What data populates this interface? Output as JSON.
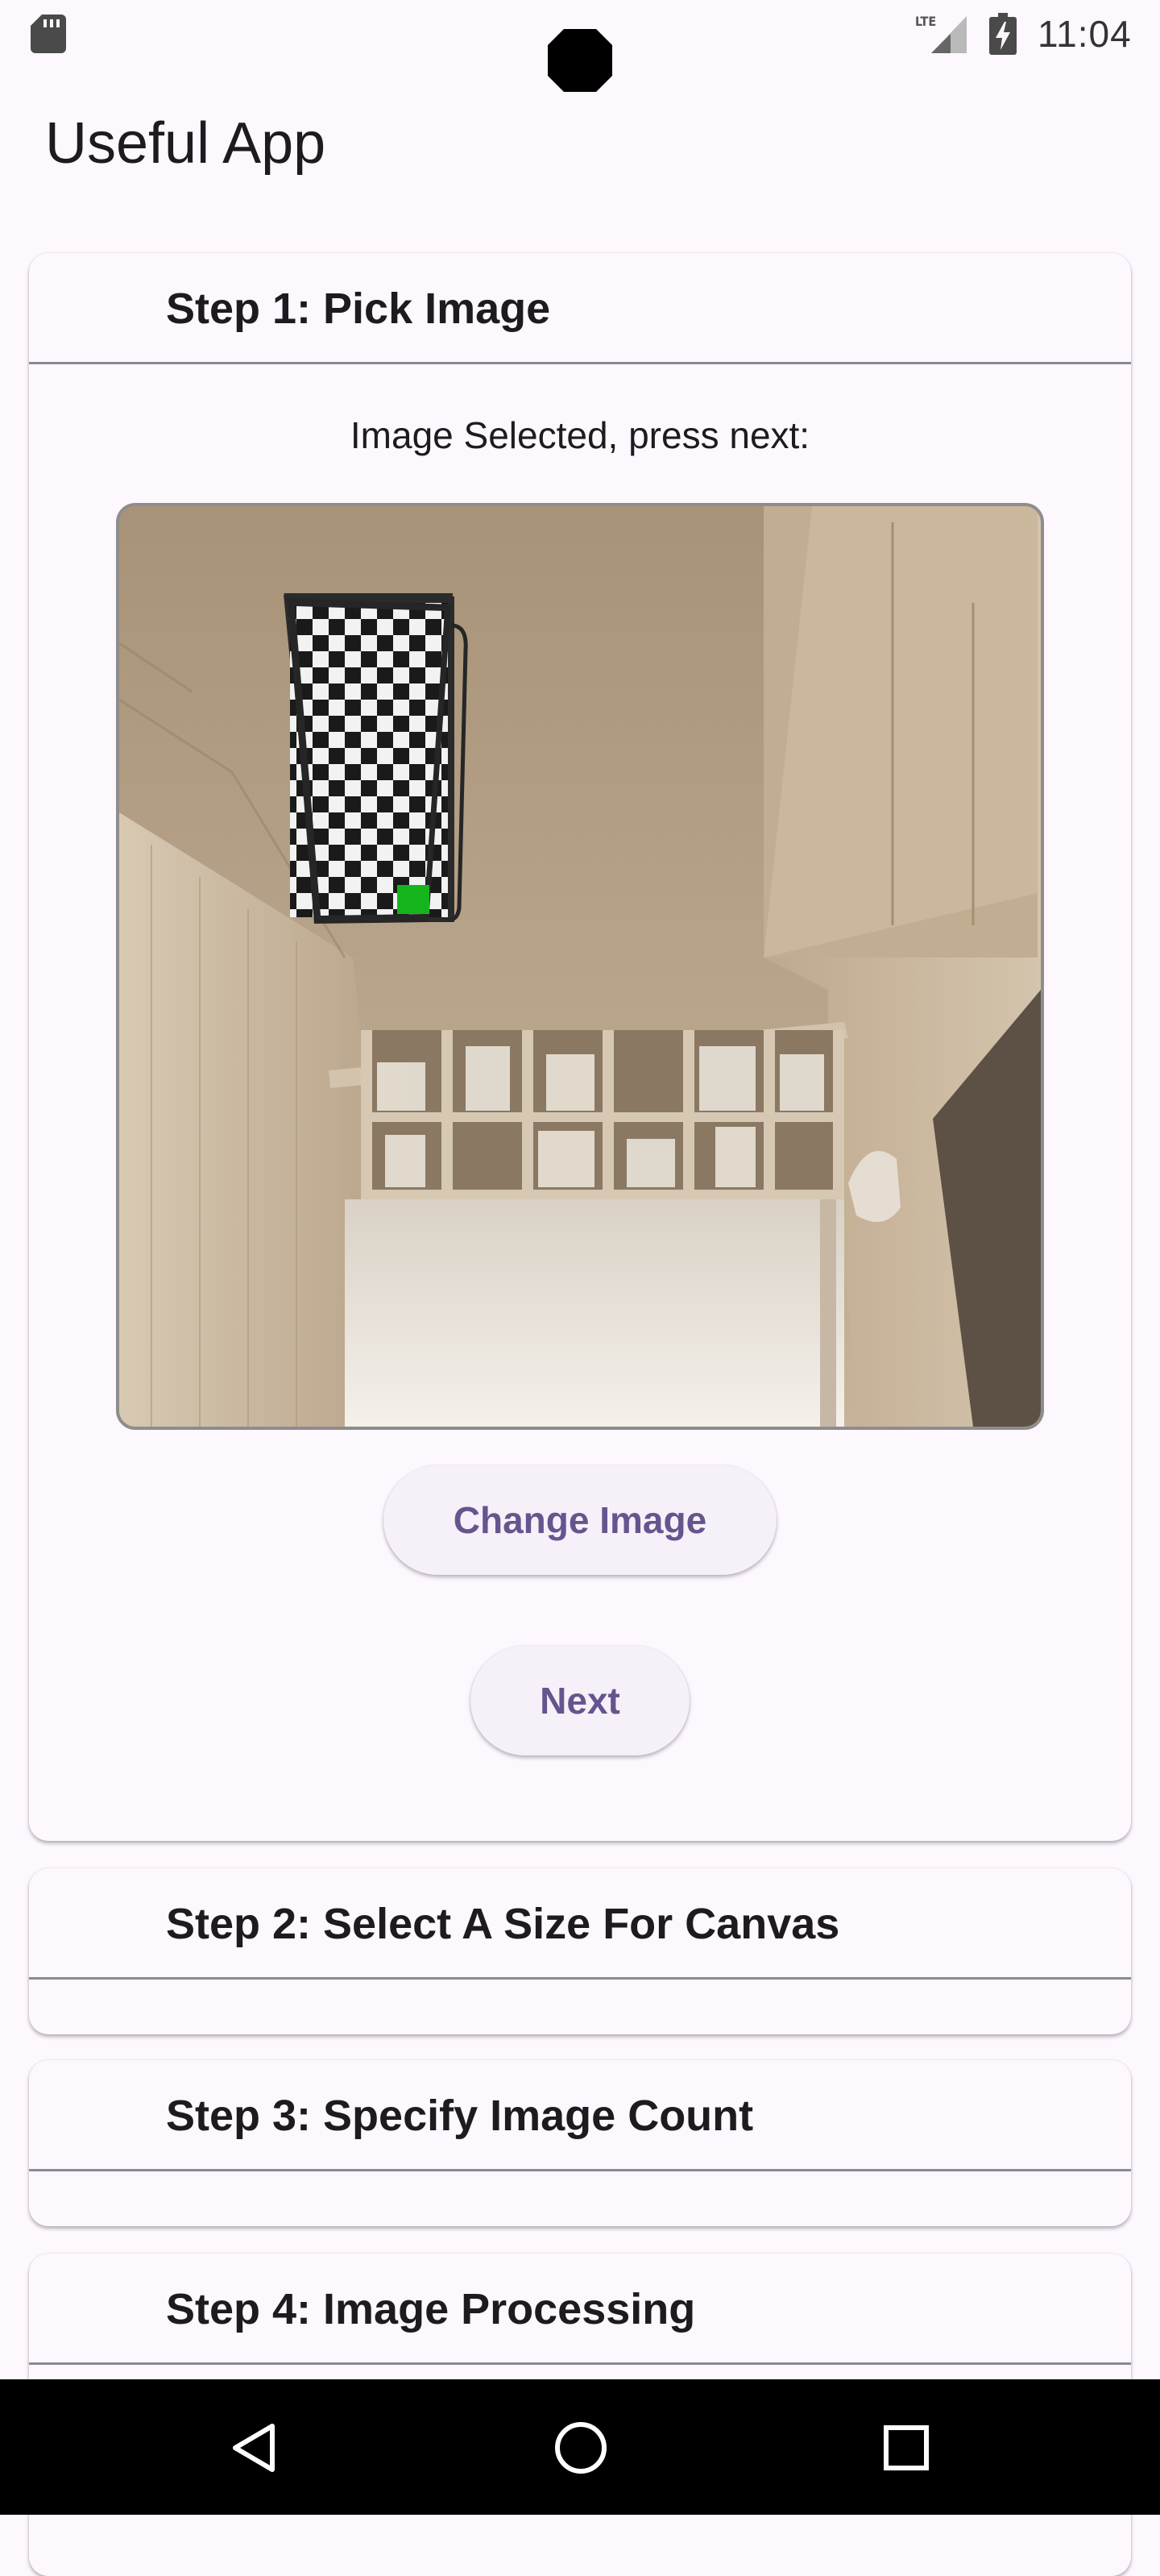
{
  "status_bar": {
    "time": "11:04",
    "network_label": "LTE",
    "icons": [
      "sd-card-icon",
      "camera-cutout",
      "lte-signal-icon",
      "battery-charging-icon"
    ]
  },
  "app_bar": {
    "title": "Useful App"
  },
  "steps": [
    {
      "title": "Step 1: Pick Image",
      "expanded": true,
      "status_text": "Image Selected, press next:",
      "change_button_label": "Change Image",
      "next_button_label": "Next"
    },
    {
      "title": "Step 2: Select A Size For Canvas",
      "expanded": false
    },
    {
      "title": "Step 3: Specify Image Count",
      "expanded": false
    },
    {
      "title": "Step 4: Image Processing",
      "expanded": false
    }
  ],
  "nav_bar": {
    "icons": [
      "back-icon",
      "home-icon",
      "recents-icon"
    ]
  },
  "colors": {
    "background": "#fdf7fe",
    "accent": "#65558f",
    "button_surface": "#f6f1f8",
    "nav_bar": "#000000",
    "checker_highlight": "#16b41c"
  }
}
